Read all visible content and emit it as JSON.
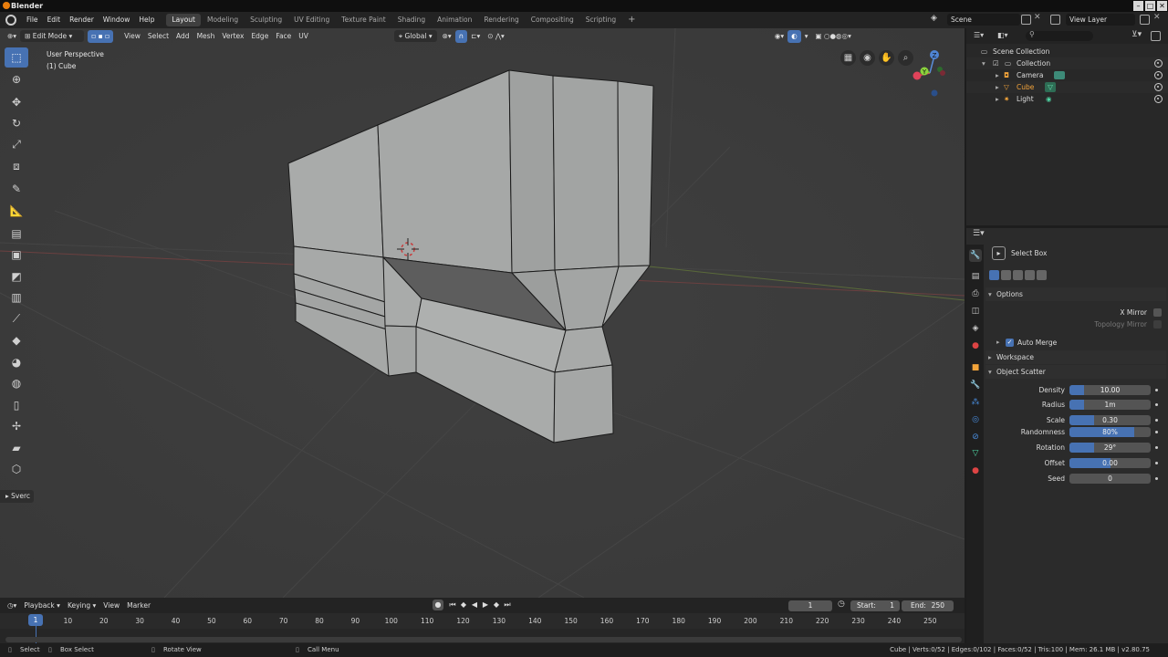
{
  "window": {
    "title": "Blender"
  },
  "menu": [
    "File",
    "Edit",
    "Render",
    "Window",
    "Help"
  ],
  "workspaces": [
    "Layout",
    "Modeling",
    "Sculpting",
    "UV Editing",
    "Texture Paint",
    "Shading",
    "Animation",
    "Rendering",
    "Compositing",
    "Scripting"
  ],
  "active_workspace": "Layout",
  "scene": {
    "name": "Scene",
    "view_layer": "View Layer"
  },
  "viewport_header": {
    "mode": "Edit Mode",
    "menus": [
      "View",
      "Select",
      "Add",
      "Mesh",
      "Vertex",
      "Edge",
      "Face",
      "UV"
    ],
    "orientation": "Global"
  },
  "viewport": {
    "perspective": "User Perspective",
    "object": "(1) Cube"
  },
  "toolbar_tools": [
    "select-box",
    "cursor",
    "move",
    "rotate",
    "scale",
    "transform",
    "annotate",
    "measure",
    "extrude",
    "inset",
    "bevel",
    "loop-cut",
    "knife",
    "poly-build",
    "spin",
    "smooth",
    "edge-slide",
    "shrink-fatten",
    "shear",
    "rip"
  ],
  "last_op_panel": "Sverc",
  "outliner": {
    "root": "Scene Collection",
    "collection": "Collection",
    "objects": [
      {
        "name": "Camera",
        "color": "#dddddd"
      },
      {
        "name": "Cube",
        "color": "#f2a33a"
      },
      {
        "name": "Light",
        "color": "#dddddd"
      }
    ]
  },
  "properties": {
    "tool_name": "Select Box",
    "options_label": "Options",
    "x_mirror": "X Mirror",
    "topology_mirror": "Topology Mirror",
    "auto_merge": "Auto Merge",
    "workspace_label": "Workspace",
    "scatter_label": "Object Scatter",
    "scatter_fields": [
      {
        "label": "Density",
        "value": "10.00",
        "fill": 0.18
      },
      {
        "label": "Radius",
        "value": "1m",
        "fill": 0.18
      },
      {
        "label": "Scale",
        "value": "0.30",
        "fill": 0.3
      },
      {
        "label": "Randomness",
        "value": "80%",
        "fill": 0.8
      },
      {
        "label": "Rotation",
        "value": "29°",
        "fill": 0.3
      },
      {
        "label": "Offset",
        "value": "0.00",
        "fill": 0.5
      },
      {
        "label": "Seed",
        "value": "0",
        "fill": 0
      }
    ]
  },
  "timeline": {
    "menus": [
      "Playback",
      "Keying",
      "View",
      "Marker"
    ],
    "current_frame": "1",
    "start_label": "Start:",
    "start": "1",
    "end_label": "End:",
    "end": "250",
    "ticks": [
      "10",
      "20",
      "30",
      "40",
      "50",
      "60",
      "70",
      "80",
      "90",
      "100",
      "110",
      "120",
      "130",
      "140",
      "150",
      "160",
      "170",
      "180",
      "190",
      "200",
      "210",
      "220",
      "230",
      "240",
      "250"
    ]
  },
  "status": {
    "select": "Select",
    "box_select": "Box Select",
    "rotate_view": "Rotate View",
    "call_menu": "Call Menu",
    "stats": "Cube | Verts:0/52 | Edges:0/102 | Faces:0/52 | Tris:100 | Mem: 26.1 MB | v2.80.75"
  },
  "colors": {
    "accent": "#4772b3",
    "viewport_bg": "#3d3d3d",
    "mesh": "#a8aaa9",
    "selected_object": "#f2a33a"
  }
}
